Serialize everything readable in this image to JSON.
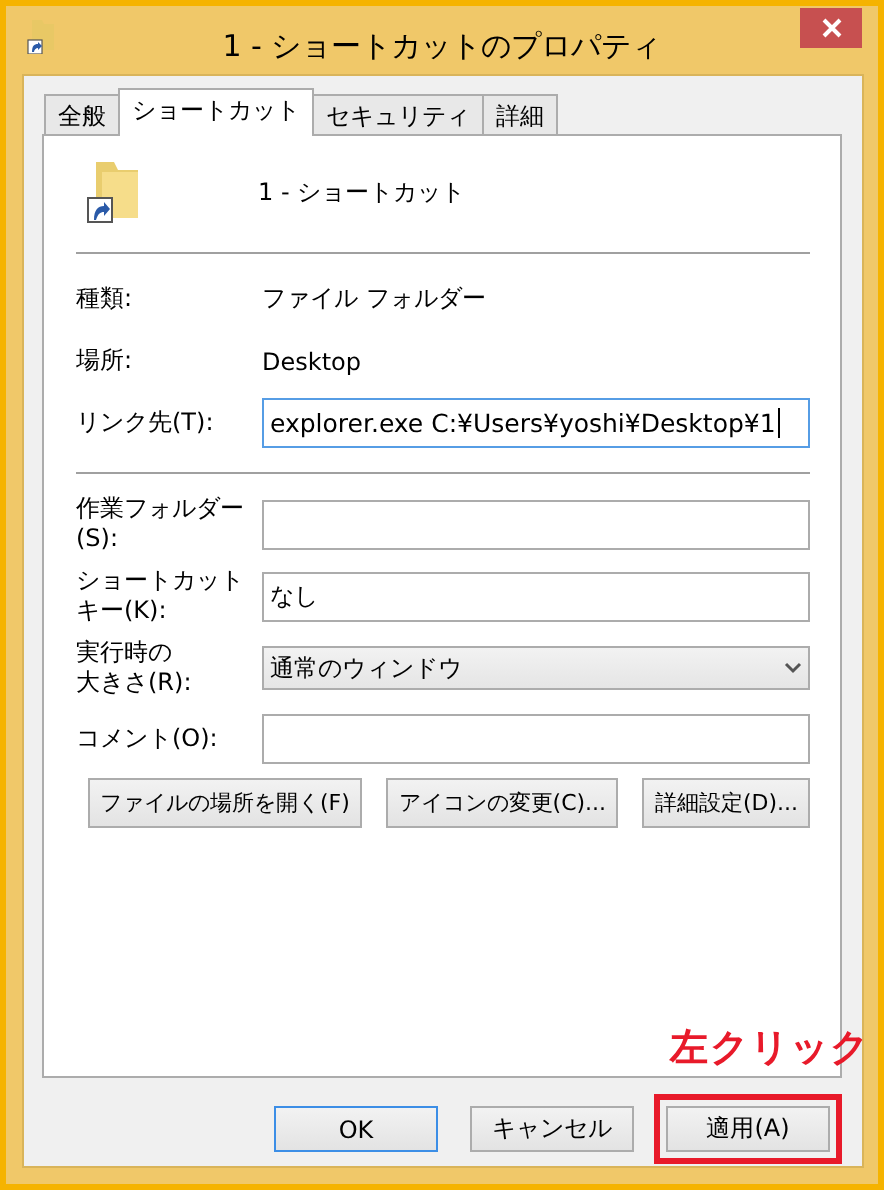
{
  "window": {
    "title": "1 - ショートカットのプロパティ"
  },
  "tabs": [
    {
      "label": "全般",
      "selected": false
    },
    {
      "label": "ショートカット",
      "selected": true
    },
    {
      "label": "セキュリティ",
      "selected": false
    },
    {
      "label": "詳細",
      "selected": false
    }
  ],
  "header": {
    "name": "1 - ショートカット"
  },
  "info": [
    {
      "label": "種類:",
      "value": "ファイル フォルダー"
    },
    {
      "label": "場所:",
      "value": "Desktop"
    }
  ],
  "target": {
    "label": "リンク先(T):",
    "value": "explorer.exe C:¥Users¥yoshi¥Desktop¥1"
  },
  "fields": [
    {
      "kind": "text",
      "label": [
        "作業フォルダー",
        "(S):"
      ]
    },
    {
      "kind": "text",
      "label": [
        "ショートカット",
        "キー(K):"
      ],
      "value": "なし"
    },
    {
      "kind": "dropdown",
      "label": [
        "実行時の",
        "大きさ(R):"
      ],
      "value": "通常のウィンドウ"
    },
    {
      "kind": "text",
      "label": [
        "コメント(O):"
      ]
    }
  ],
  "actions": [
    "ファイルの場所を開く(F)",
    "アイコンの変更(C)...",
    "詳細設定(D)..."
  ],
  "buttons": [
    {
      "label": "OK",
      "default": true,
      "highlighted": false
    },
    {
      "label": "キャンセル",
      "default": false,
      "highlighted": false
    },
    {
      "label": "適用(A)",
      "default": false,
      "highlighted": true
    }
  ],
  "annotation": {
    "text": "左クリック"
  }
}
